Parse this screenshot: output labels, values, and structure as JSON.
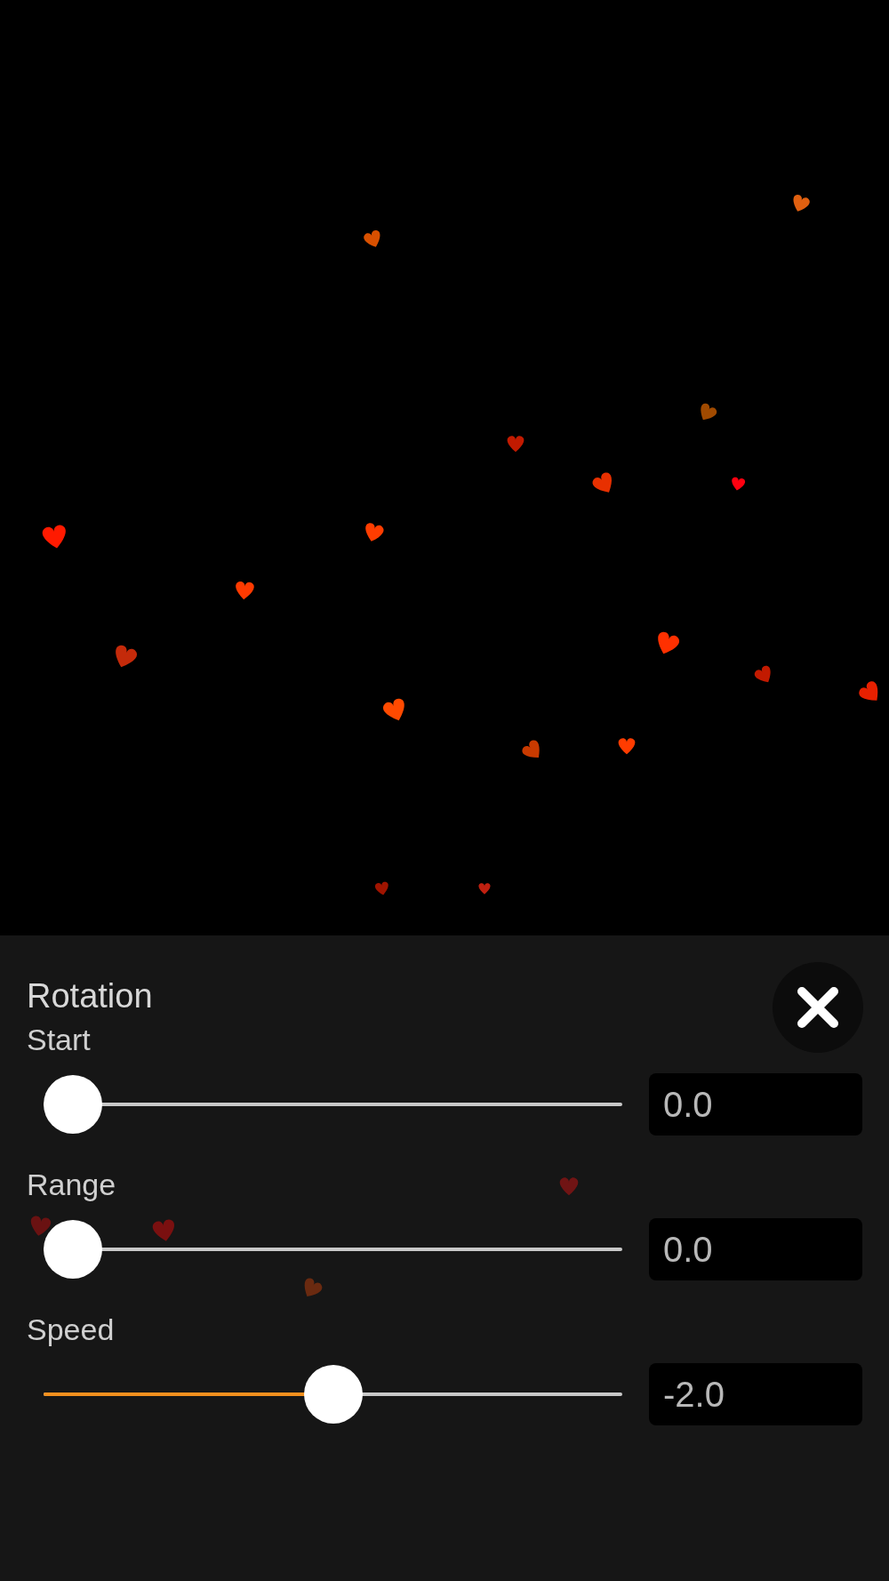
{
  "panel": {
    "title": "Rotation"
  },
  "sliders": [
    {
      "label": "Start",
      "level": 0,
      "value": "0.0"
    },
    {
      "label": "Range",
      "level": 0,
      "value": "0.0"
    },
    {
      "label": "Speed",
      "level": 0.5,
      "value": "-2.0"
    }
  ]
}
